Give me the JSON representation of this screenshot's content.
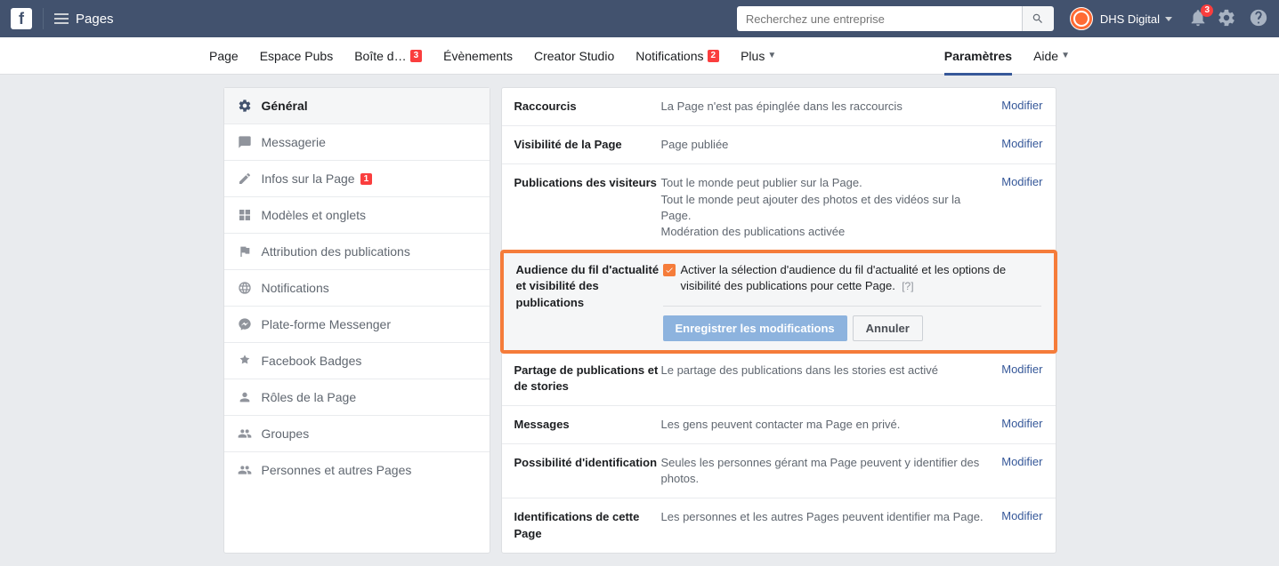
{
  "topbar": {
    "app_title": "Pages",
    "search_placeholder": "Recherchez une entreprise",
    "user_name": "DHS Digital",
    "notification_count": "3"
  },
  "tabs": {
    "left": [
      {
        "label": "Page"
      },
      {
        "label": "Espace Pubs"
      },
      {
        "label": "Boîte d…",
        "badge": "3"
      },
      {
        "label": "Évènements"
      },
      {
        "label": "Creator Studio"
      },
      {
        "label": "Notifications",
        "badge": "2"
      },
      {
        "label": "Plus",
        "caret": true
      }
    ],
    "right": [
      {
        "label": "Paramètres",
        "active": true
      },
      {
        "label": "Aide",
        "caret": true
      }
    ]
  },
  "sidebar": [
    {
      "label": "Général",
      "icon": "gear",
      "active": true
    },
    {
      "label": "Messagerie",
      "icon": "chat"
    },
    {
      "label": "Infos sur la Page",
      "icon": "pencil",
      "badge": "1"
    },
    {
      "label": "Modèles et onglets",
      "icon": "grid"
    },
    {
      "label": "Attribution des publications",
      "icon": "flag"
    },
    {
      "label": "Notifications",
      "icon": "globe"
    },
    {
      "label": "Plate-forme Messenger",
      "icon": "messenger"
    },
    {
      "label": "Facebook Badges",
      "icon": "badge"
    },
    {
      "label": "Rôles de la Page",
      "icon": "person"
    },
    {
      "label": "Groupes",
      "icon": "people"
    },
    {
      "label": "Personnes et autres Pages",
      "icon": "people"
    }
  ],
  "settings": [
    {
      "label": "Raccourcis",
      "desc": "La Page n'est pas épinglée dans les raccourcis",
      "action": "Modifier"
    },
    {
      "label": "Visibilité de la Page",
      "desc": "Page publiée",
      "action": "Modifier"
    },
    {
      "label": "Publications des visiteurs",
      "desc": "Tout le monde peut publier sur la Page.\nTout le monde peut ajouter des photos et des vidéos sur la Page.\nModération des publications activée",
      "action": "Modifier"
    }
  ],
  "highlighted": {
    "label": "Audience du fil d'actualité et visibilité des publications",
    "text": "Activer la sélection d'audience du fil d'actualité et les options de visibilité des publications pour cette Page.",
    "help": "[?]",
    "save": "Enregistrer les modifications",
    "cancel": "Annuler"
  },
  "settings2": [
    {
      "label": "Partage de publications et de stories",
      "desc": "Le partage des publications dans les stories est activé",
      "action": "Modifier"
    },
    {
      "label": "Messages",
      "desc": "Les gens peuvent contacter ma Page en privé.",
      "action": "Modifier"
    },
    {
      "label": "Possibilité d'identification",
      "desc": "Seules les personnes gérant ma Page peuvent y identifier des photos.",
      "action": "Modifier"
    },
    {
      "label": "Identifications de cette Page",
      "desc": "Les personnes et les autres Pages peuvent identifier ma Page.",
      "action": "Modifier"
    }
  ]
}
